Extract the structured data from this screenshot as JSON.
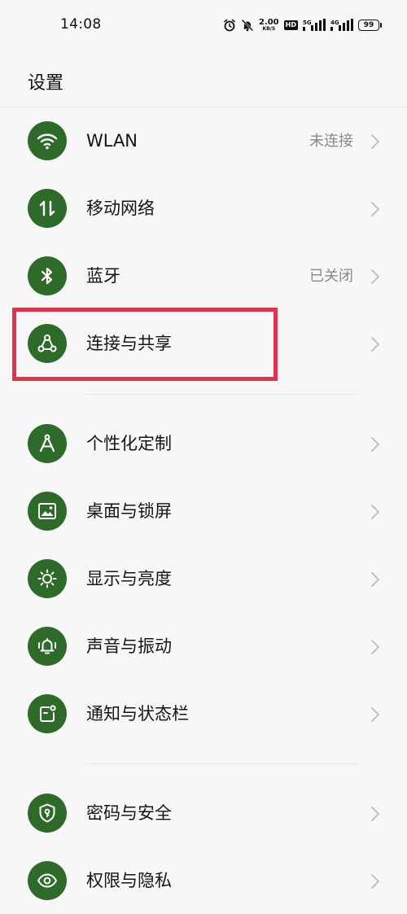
{
  "status_bar": {
    "time": "14:08",
    "net_speed_value": "2.00",
    "net_speed_unit": "KB/S",
    "hd_badge": "HD",
    "signal1_label": "5G",
    "signal2_label": "4G",
    "battery_level": "99",
    "icons": [
      "alarm-icon",
      "mute-icon",
      "signal-icon",
      "signal-icon",
      "battery-icon"
    ]
  },
  "header": {
    "title": "设置"
  },
  "settings": {
    "items": [
      {
        "label": "WLAN",
        "value": "未连接",
        "icon": "wifi-icon"
      },
      {
        "label": "移动网络",
        "value": "",
        "icon": "mobile-network-icon"
      },
      {
        "label": "蓝牙",
        "value": "已关闭",
        "icon": "bluetooth-icon"
      },
      {
        "label": "连接与共享",
        "value": "",
        "icon": "share-icon"
      },
      {
        "label": "个性化定制",
        "value": "",
        "icon": "compass-icon"
      },
      {
        "label": "桌面与锁屏",
        "value": "",
        "icon": "picture-icon"
      },
      {
        "label": "显示与亮度",
        "value": "",
        "icon": "brightness-icon"
      },
      {
        "label": "声音与振动",
        "value": "",
        "icon": "bell-icon"
      },
      {
        "label": "通知与状态栏",
        "value": "",
        "icon": "notification-icon"
      },
      {
        "label": "密码与安全",
        "value": "",
        "icon": "shield-icon"
      },
      {
        "label": "权限与隐私",
        "value": "",
        "icon": "eye-icon"
      }
    ]
  },
  "colors": {
    "icon_background": "#2e6b2b",
    "highlight": "#e0334c",
    "value_text": "#8a8a8a"
  }
}
